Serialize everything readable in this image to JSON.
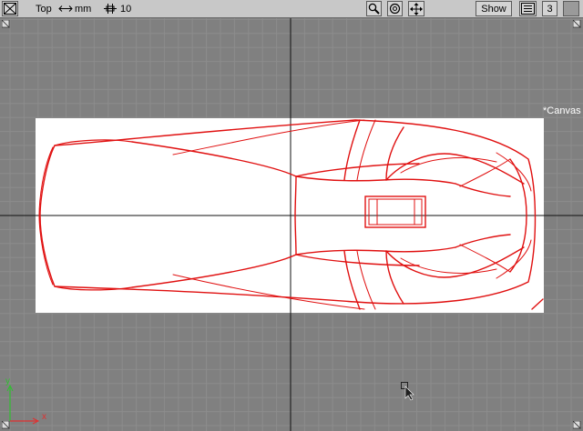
{
  "toolbar": {
    "view_name": "Top",
    "unit_label": "mm",
    "grid_value": "10",
    "show_button": "Show",
    "layer_number": "3"
  },
  "canvas": {
    "label": "*Canvas"
  },
  "axes": {
    "x_label": "x",
    "y_label": "y"
  },
  "icons": {
    "maximize": "maximize-icon",
    "move_horizontal": "horizontal-arrows-icon",
    "grid_snap": "grid-snap-icon",
    "zoom": "zoom-icon",
    "tumble": "tumble-icon",
    "pan": "pan-icon",
    "layout": "layout-icon",
    "cursor": "cursor-icon"
  },
  "colors": {
    "viewport_bg": "#808080",
    "grid_line": "#8c8c8c",
    "axis_line": "#101010",
    "sketch_red": "#e01010",
    "axis_x": "#e03030",
    "axis_y": "#30c030",
    "toolbar_bg": "#c8c8c8"
  }
}
